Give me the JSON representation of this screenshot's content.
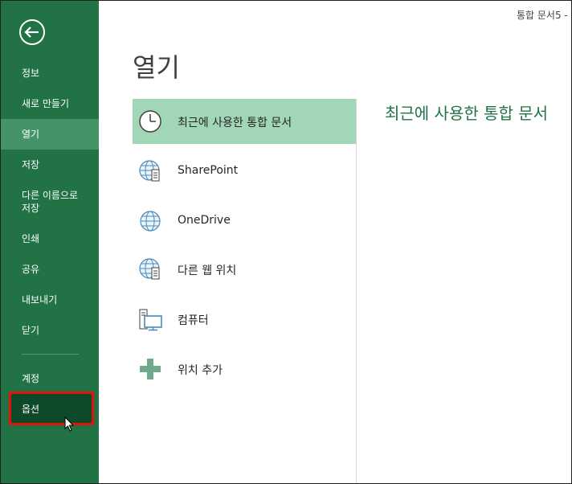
{
  "window": {
    "title": "통합 문서5 -"
  },
  "sidebar": {
    "items": [
      {
        "label": "정보"
      },
      {
        "label": "새로 만들기"
      },
      {
        "label": "열기"
      },
      {
        "label": "저장"
      },
      {
        "label": "다른 이름으로",
        "label2": "저장"
      },
      {
        "label": "인쇄"
      },
      {
        "label": "공유"
      },
      {
        "label": "내보내기"
      },
      {
        "label": "닫기"
      },
      {
        "label": "계정"
      },
      {
        "label": "옵션"
      }
    ],
    "active": "열기",
    "colors": {
      "background": "#217346",
      "active": "#439467",
      "highlight_border": "#e3120b"
    }
  },
  "main": {
    "title": "열기",
    "places": [
      {
        "label": "최근에 사용한 통합 문서",
        "icon": "clock-icon"
      },
      {
        "label": "SharePoint",
        "icon": "sharepoint-globe-icon"
      },
      {
        "label": "OneDrive",
        "icon": "onedrive-globe-icon"
      },
      {
        "label": "다른 웹 위치",
        "icon": "web-location-globe-icon"
      },
      {
        "label": "컴퓨터",
        "icon": "computer-icon"
      },
      {
        "label": "위치 추가",
        "icon": "plus-icon"
      }
    ],
    "section_title": "최근에 사용한 통합 문서"
  }
}
